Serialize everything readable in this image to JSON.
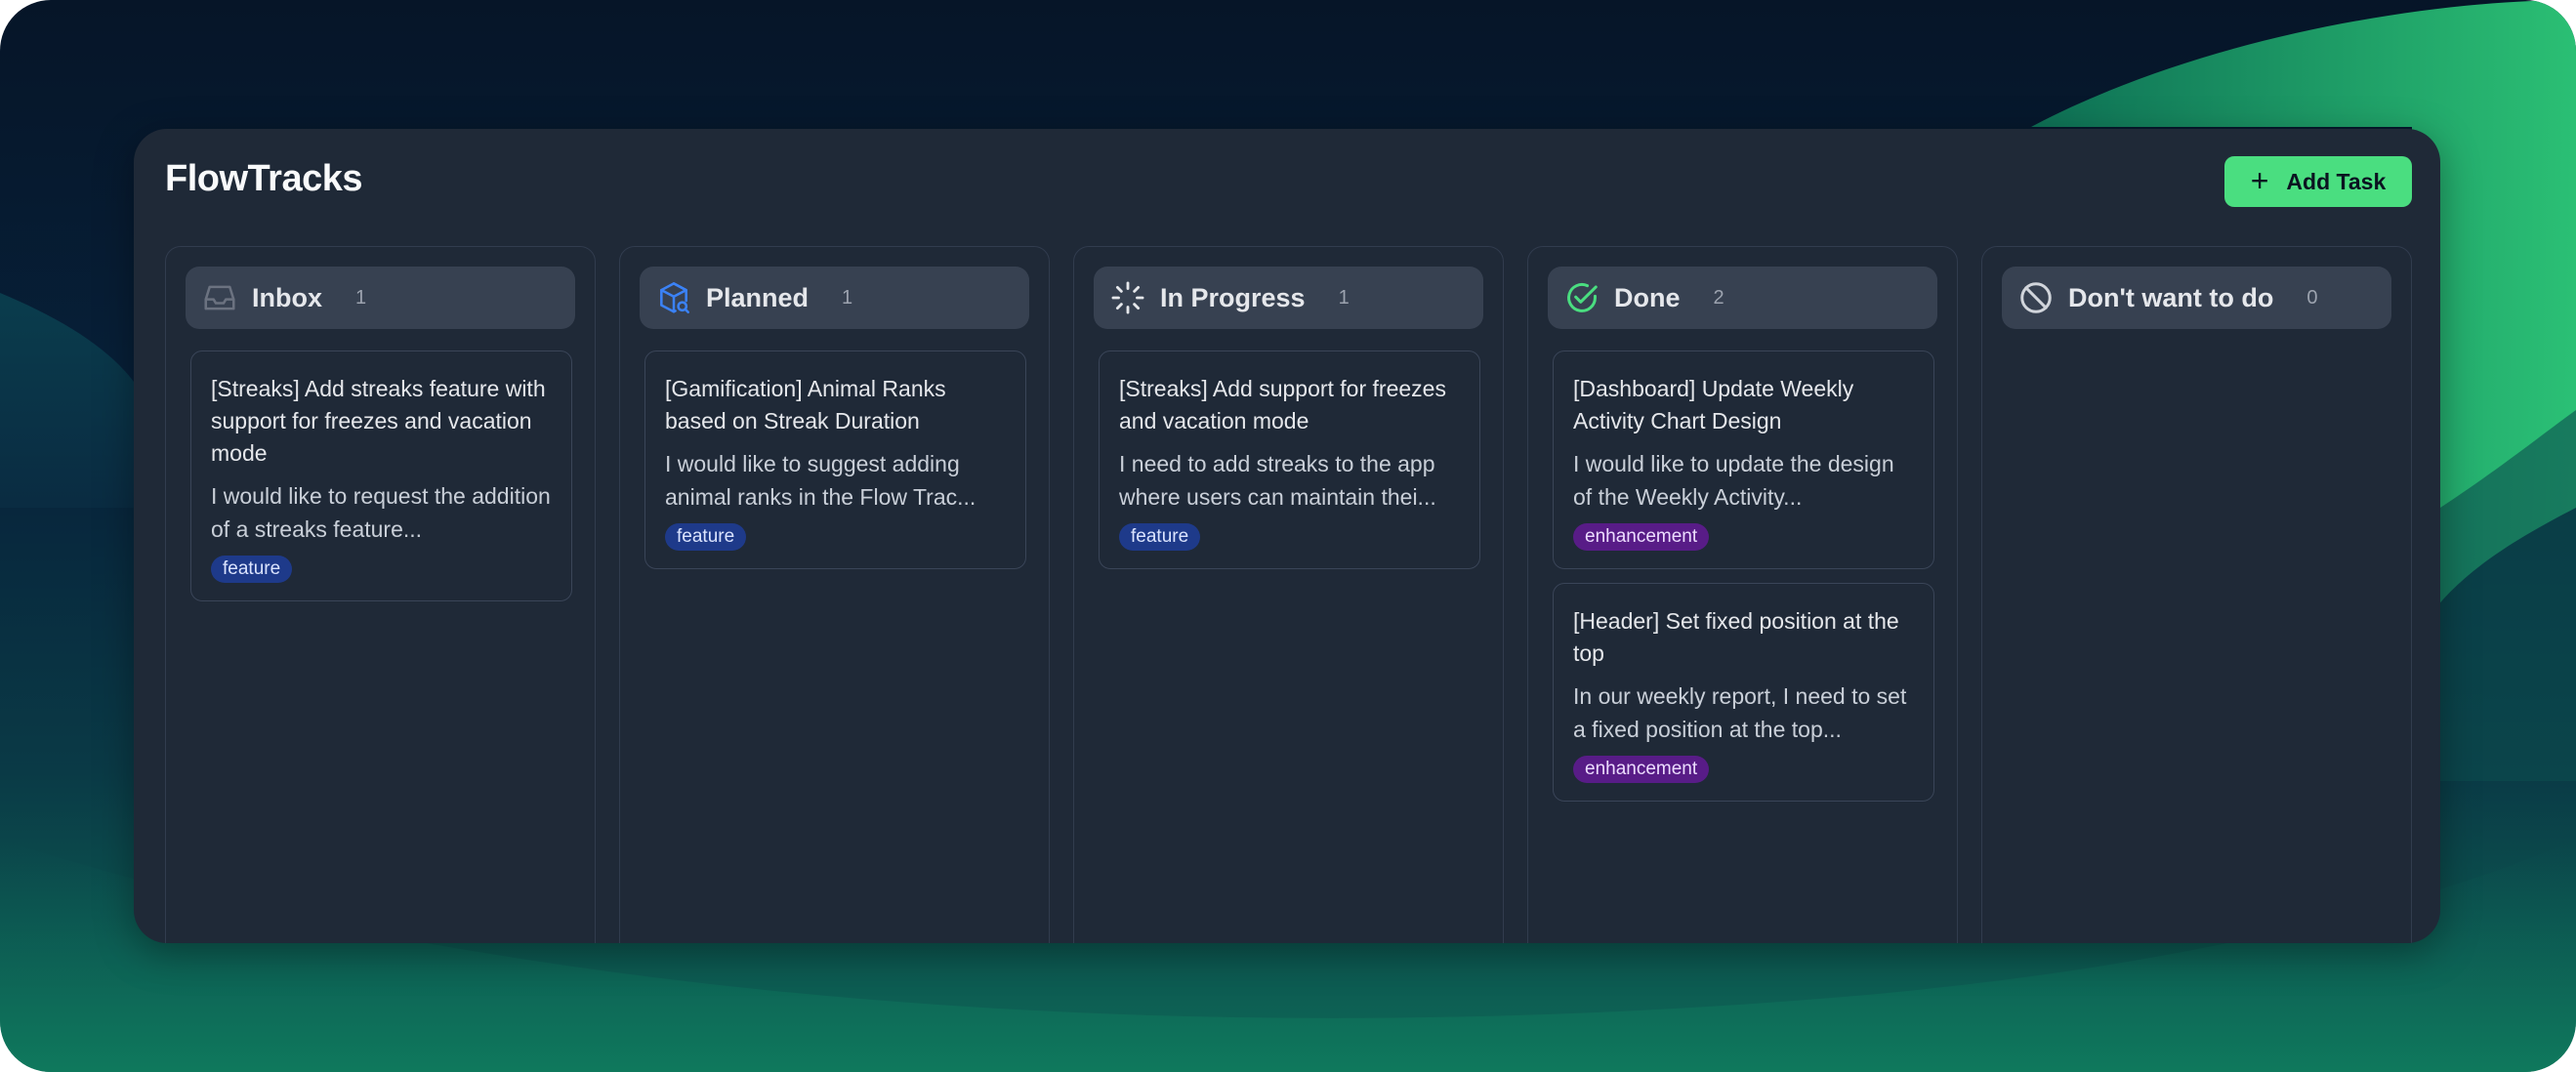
{
  "app": {
    "title": "FlowTracks"
  },
  "toolbar": {
    "add_task_label": "Add Task",
    "add_task_icon": "plus-icon"
  },
  "colors": {
    "accent": "#4ade80",
    "panel": "#1f2937",
    "header": "#374151",
    "feature_tag": "#1e3a8a",
    "enhancement_tag": "#581c87"
  },
  "columns": [
    {
      "title": "Inbox",
      "count": "1",
      "icon": "inbox-icon",
      "cards": [
        {
          "title": "[Streaks] Add streaks feature with support for freezes and vacation mode",
          "description": "I would like to request the addition of a streaks feature...",
          "tag": "feature"
        }
      ]
    },
    {
      "title": "Planned",
      "count": "1",
      "icon": "box-search-icon",
      "cards": [
        {
          "title": "[Gamification] Animal Ranks based on Streak Duration",
          "description": "I would like to suggest adding animal ranks in the Flow Trac...",
          "tag": "feature"
        }
      ]
    },
    {
      "title": "In Progress",
      "count": "1",
      "icon": "loader-icon",
      "cards": [
        {
          "title": "[Streaks] Add support for freezes and vacation mode",
          "description": "I need to add streaks to the app where users can maintain thei...",
          "tag": "feature"
        }
      ]
    },
    {
      "title": "Done",
      "count": "2",
      "icon": "check-circle-icon",
      "cards": [
        {
          "title": "[Dashboard] Update Weekly Activity Chart Design",
          "description": "I would like to update the design of the Weekly Activity...",
          "tag": "enhancement"
        },
        {
          "title": "[Header] Set fixed position at the top",
          "description": "In our weekly report, I need to set a fixed position at the top...",
          "tag": "enhancement"
        }
      ]
    },
    {
      "title": "Don't want to do",
      "count": "0",
      "icon": "ban-icon",
      "cards": []
    }
  ]
}
